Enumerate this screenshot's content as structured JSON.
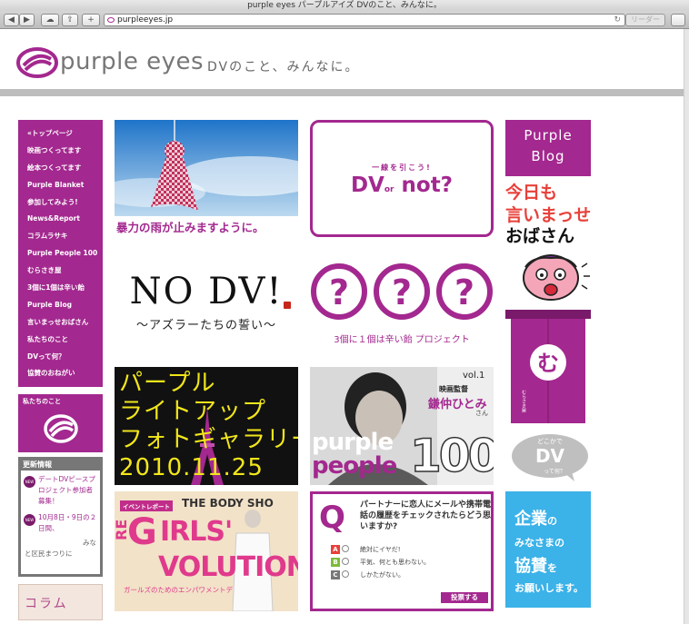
{
  "browser": {
    "window_title": "purple eyes パープルアイズ DVのこと、みんなに。",
    "url": "purpleeyes.jp",
    "reader_label": "リーダー"
  },
  "header": {
    "logo_text": "purple eyes",
    "tagline": "DVのこと、みんなに。"
  },
  "sidebar": {
    "nav": [
      "«トップページ",
      "映画つくってます",
      "絵本つくってます",
      "Purple Blanket",
      "参加してみよう!",
      "News&Report",
      "コラムラサキ",
      "Purple People 100",
      "むらさき屋",
      "3個に1個は辛い飴",
      "Purple Blog",
      "言いまっせおばさん",
      "私たちのこと",
      "DVって何？",
      "協賛のおねがい"
    ],
    "about_label": "私たちのこと",
    "news_title": "更新情報",
    "news_items": [
      {
        "badge": "NEW",
        "text": "デートDVピースプロジェクト参加者募集！"
      },
      {
        "badge": "NEW",
        "text": "10月8日・9日の２日間、"
      }
    ],
    "news_extra": [
      "みな",
      "と区民まつりに"
    ],
    "column_label": "コラム"
  },
  "tiles": {
    "rain_caption": "暴力の雨が止みますように。",
    "dvnot_sub": "一線を引こう!",
    "dvnot_dv": "DV",
    "dvnot_or": "or",
    "dvnot_not": "not?",
    "nodv_title": "NO DV!",
    "nodv_sub": "〜アズラーたちの誓い〜",
    "qqq_caption": "3個に１個は辛い飴 プロジェクト",
    "lightup_lines": [
      "パープル",
      "ライトアップ",
      "フォトギャラリー",
      "2010.11.25"
    ],
    "people_vol": "vol.1",
    "people_role": "映画監督",
    "people_name": "鎌仲ひとみ",
    "people_san": "さん",
    "people_purple": "purple",
    "people_people": "people",
    "people_100": "100",
    "girls_event": "イベントレポート",
    "girls_shop": "THE BODY SHO",
    "girls_g": "G",
    "girls_rl": "IRLS'",
    "girls_re": "RE",
    "girls_volution": "VOLUTION",
    "girls_sub": "ガールズのためのエンパワメントデ",
    "poll_q": "Q",
    "poll_question": "パートナーに恋人にメールや携帯電話の履歴をチェックされたらどう思いますか?",
    "poll_options": [
      {
        "letter": "A",
        "text": "絶対にイヤだ!",
        "color": "#e8403a"
      },
      {
        "letter": "B",
        "text": "平気、何とも思わない。",
        "color": "#7dbb3a"
      },
      {
        "letter": "C",
        "text": "しかたがない。",
        "color": "#777777"
      }
    ],
    "poll_button": "投票する"
  },
  "right": {
    "blog_line1": "Purple",
    "blog_line2": "Blog",
    "kyou_line1": "今日も",
    "kyou_line2": "言いまっせ",
    "obasan": "おばさん",
    "noren_text": "むらさき屋",
    "bubble_top": "どこかで",
    "bubble_main": "DV",
    "bubble_bottom": "って何？",
    "sponsor_line1_big": "企業",
    "sponsor_line1_small": "の",
    "sponsor_line2": "みなさまの",
    "sponsor_line3_big": "協賛",
    "sponsor_line3_small": "を",
    "sponsor_line4": "お願いします。"
  },
  "colors": {
    "brand_purple": "#a3288f",
    "sponsor_blue": "#3bb2e8",
    "alert_red": "#e8403a"
  }
}
